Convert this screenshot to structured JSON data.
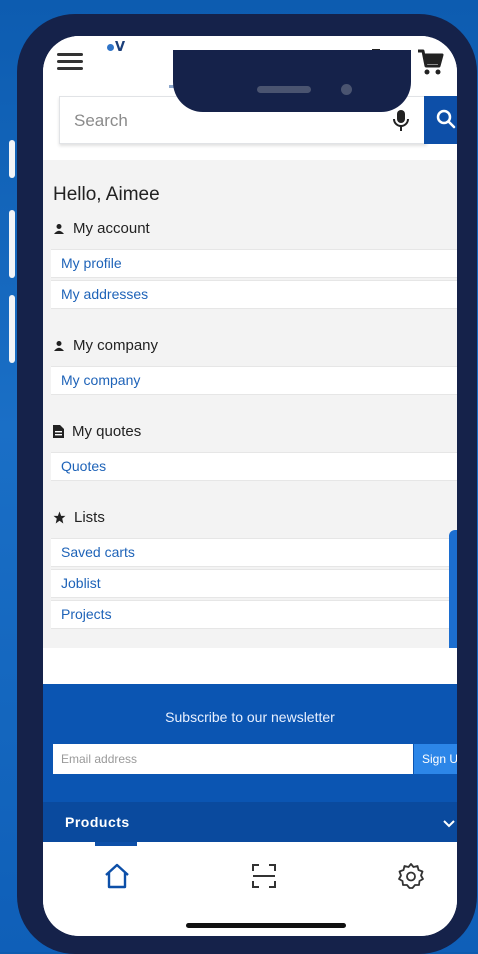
{
  "search": {
    "placeholder": "Search"
  },
  "account": {
    "greeting": "Hello, Aimee",
    "sections": [
      {
        "title": "My account",
        "icon": "person-icon",
        "links": [
          "My profile",
          "My addresses"
        ]
      },
      {
        "title": "My company",
        "icon": "person-icon",
        "links": [
          "My company"
        ]
      },
      {
        "title": "My quotes",
        "icon": "document-icon",
        "links": [
          "Quotes"
        ]
      },
      {
        "title": "Lists",
        "icon": "star-icon",
        "links": [
          "Saved carts",
          "Joblist",
          "Projects"
        ]
      }
    ]
  },
  "newsletter": {
    "title": "Subscribe to our newsletter",
    "email_placeholder": "Email address",
    "signup_label": "Sign U"
  },
  "footer": {
    "products_label": "Products"
  },
  "nav": {
    "items": [
      "home-icon",
      "scan-icon",
      "settings-icon"
    ]
  },
  "colors": {
    "primary_blue": "#0d4fa8",
    "link_blue": "#1e63b8",
    "frame_navy": "#15224a"
  }
}
